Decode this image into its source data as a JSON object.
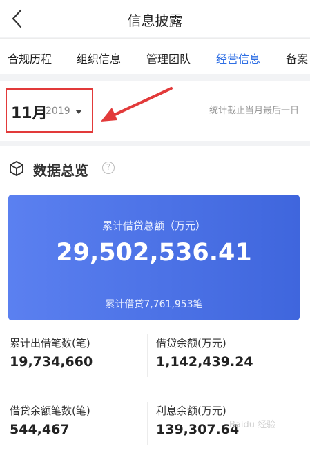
{
  "header": {
    "title": "信息披露"
  },
  "tabs": [
    {
      "label": "合规历程"
    },
    {
      "label": "组织信息"
    },
    {
      "label": "管理团队"
    },
    {
      "label": "经营信息"
    },
    {
      "label": "备案"
    }
  ],
  "active_tab": "经营信息",
  "date_selector": {
    "month": "11月",
    "year": "2019"
  },
  "cutoff_note": "统计截止当月最后一日",
  "overview": {
    "title": "数据总览",
    "help": "?",
    "card": {
      "label": "累计借贷总额（万元）",
      "value": "29,502,536.41",
      "footer": "累计借贷7,761,953笔"
    },
    "stats": [
      {
        "label": "累计出借笔数(笔)",
        "value": "19,734,660"
      },
      {
        "label": "借贷余额(万元)",
        "value": "1,142,439.24"
      },
      {
        "label": "借贷余额笔数(笔)",
        "value": "544,467"
      },
      {
        "label": "利息余额(万元)",
        "value": "139,307.64"
      }
    ]
  },
  "watermark": "Baidu 经验",
  "colors": {
    "accent": "#2f6fe4",
    "highlight": "#e23a3a",
    "card": "#4a70e4"
  }
}
